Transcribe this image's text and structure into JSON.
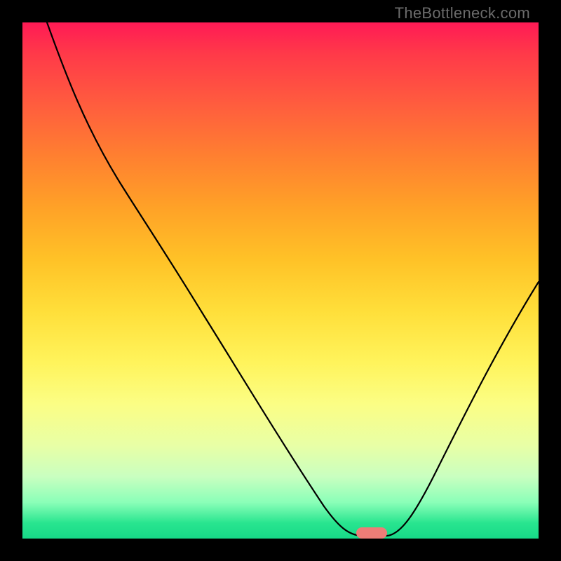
{
  "watermark": "TheBottleneck.com",
  "chart_data": {
    "type": "line",
    "title": "",
    "xlabel": "",
    "ylabel": "",
    "xlim": [
      0,
      100
    ],
    "ylim": [
      0,
      100
    ],
    "grid": false,
    "legend": false,
    "x": [
      0,
      8,
      16,
      24,
      30,
      36,
      42,
      48,
      54,
      60,
      64,
      66,
      68,
      70,
      72,
      76,
      82,
      88,
      94,
      100
    ],
    "bottleneck_pct": [
      100,
      90,
      80,
      70,
      62,
      52,
      42,
      32,
      22,
      12,
      4,
      1,
      0,
      0,
      2,
      8,
      18,
      28,
      38,
      48
    ],
    "optimal_x": 68,
    "marker_color": "#ee7d77"
  }
}
